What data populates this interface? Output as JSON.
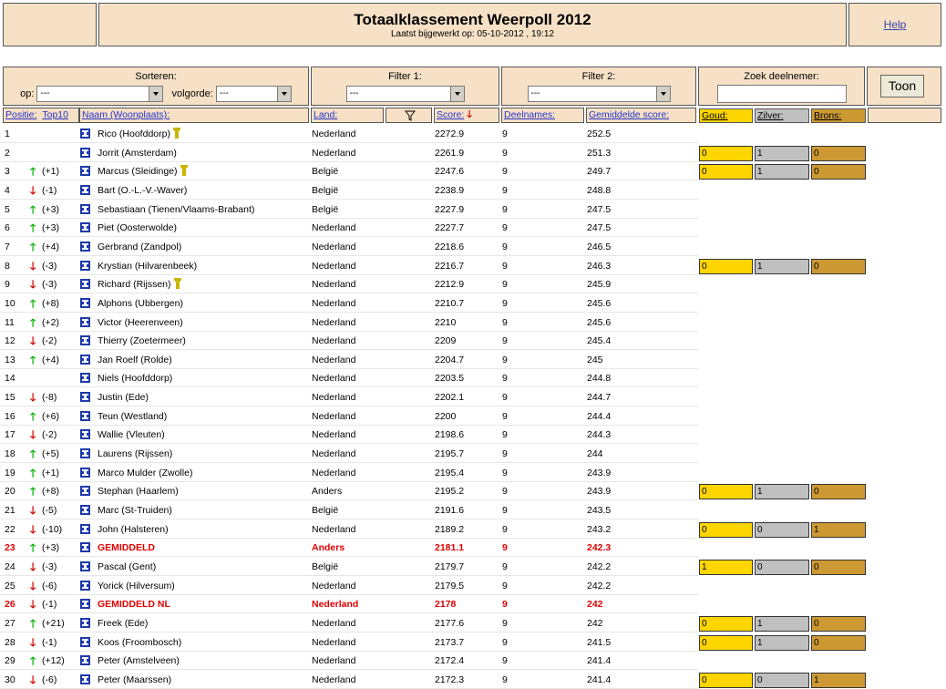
{
  "header": {
    "title": "Totaalklassement Weerpoll 2012",
    "subtitle": "Laatst bijgewerkt op: 05-10-2012 , 19:12",
    "help": "Help"
  },
  "controls": {
    "sorteren_label": "Sorteren:",
    "op_label": "op:",
    "op_value": "---",
    "volgorde_label": "volgorde:",
    "volgorde_value": "---",
    "filter1_label": "Filter 1:",
    "filter1_value": "---",
    "filter2_label": "Filter 2:",
    "filter2_value": "---",
    "zoek_label": "Zoek deelnemer:",
    "zoek_value": "",
    "toon": "Toon"
  },
  "columns": {
    "positie": "Positie:",
    "top10": "Top10",
    "naam": "Naam (Woonplaats):",
    "land": "Land:",
    "score": "Score:",
    "deelnames": "Deelnames:",
    "gemiddelde": "Gemiddelde score:",
    "goud": "Goud:",
    "zilver": "Zilver:",
    "brons": "Brons:"
  },
  "colors": {
    "gold": "#ffd500",
    "silver": "#c0c0c0",
    "bronze": "#cc9933",
    "panel": "#f7e1c6",
    "up": "#00b000",
    "down": "#d00000",
    "highlight": "#e00000"
  },
  "rows": [
    {
      "pos": "1",
      "dir": "",
      "chg": "",
      "name": "Rico (Hoofddorp)",
      "trophy": true,
      "land": "Nederland",
      "score": "2272.9",
      "deel": "9",
      "gem": "252.5",
      "medals": null
    },
    {
      "pos": "2",
      "dir": "",
      "chg": "",
      "name": "Jorrit (Amsterdam)",
      "trophy": false,
      "land": "Nederland",
      "score": "2261.9",
      "deel": "9",
      "gem": "251.3",
      "medals": [
        "0",
        "1",
        "0"
      ]
    },
    {
      "pos": "3",
      "dir": "up",
      "chg": "(+1)",
      "name": "Marcus (Sleidinge)",
      "trophy": true,
      "land": "België",
      "score": "2247.6",
      "deel": "9",
      "gem": "249.7",
      "medals": [
        "0",
        "1",
        "0"
      ]
    },
    {
      "pos": "4",
      "dir": "down",
      "chg": "(-1)",
      "name": "Bart (O.-L.-V.-Waver)",
      "trophy": false,
      "land": "België",
      "score": "2238.9",
      "deel": "9",
      "gem": "248.8",
      "medals": null
    },
    {
      "pos": "5",
      "dir": "up",
      "chg": "(+3)",
      "name": "Sebastiaan (Tienen/Vlaams-Brabant)",
      "trophy": false,
      "land": "België",
      "score": "2227.9",
      "deel": "9",
      "gem": "247.5",
      "medals": null
    },
    {
      "pos": "6",
      "dir": "up",
      "chg": "(+3)",
      "name": "Piet (Oosterwolde)",
      "trophy": false,
      "land": "Nederland",
      "score": "2227.7",
      "deel": "9",
      "gem": "247.5",
      "medals": null
    },
    {
      "pos": "7",
      "dir": "up",
      "chg": "(+4)",
      "name": "Gerbrand (Zandpol)",
      "trophy": false,
      "land": "Nederland",
      "score": "2218.6",
      "deel": "9",
      "gem": "246.5",
      "medals": null
    },
    {
      "pos": "8",
      "dir": "down",
      "chg": "(-3)",
      "name": "Krystian (Hilvarenbeek)",
      "trophy": false,
      "land": "Nederland",
      "score": "2216.7",
      "deel": "9",
      "gem": "246.3",
      "medals": [
        "0",
        "1",
        "0"
      ]
    },
    {
      "pos": "9",
      "dir": "down",
      "chg": "(-3)",
      "name": "Richard (Rijssen)",
      "trophy": true,
      "land": "Nederland",
      "score": "2212.9",
      "deel": "9",
      "gem": "245.9",
      "medals": null
    },
    {
      "pos": "10",
      "dir": "up",
      "chg": "(+8)",
      "name": "Alphons (Ubbergen)",
      "trophy": false,
      "land": "Nederland",
      "score": "2210.7",
      "deel": "9",
      "gem": "245.6",
      "medals": null
    },
    {
      "pos": "11",
      "dir": "up",
      "chg": "(+2)",
      "name": "Victor (Heerenveen)",
      "trophy": false,
      "land": "Nederland",
      "score": "2210",
      "deel": "9",
      "gem": "245.6",
      "medals": null
    },
    {
      "pos": "12",
      "dir": "down",
      "chg": "(-2)",
      "name": "Thierry (Zoetermeer)",
      "trophy": false,
      "land": "Nederland",
      "score": "2209",
      "deel": "9",
      "gem": "245.4",
      "medals": null
    },
    {
      "pos": "13",
      "dir": "up",
      "chg": "(+4)",
      "name": "Jan Roelf (Rolde)",
      "trophy": false,
      "land": "Nederland",
      "score": "2204.7",
      "deel": "9",
      "gem": "245",
      "medals": null
    },
    {
      "pos": "14",
      "dir": "",
      "chg": "",
      "name": "Niels (Hoofddorp)",
      "trophy": false,
      "land": "Nederland",
      "score": "2203.5",
      "deel": "9",
      "gem": "244.8",
      "medals": null
    },
    {
      "pos": "15",
      "dir": "down",
      "chg": "(-8)",
      "name": "Justin (Ede)",
      "trophy": false,
      "land": "Nederland",
      "score": "2202.1",
      "deel": "9",
      "gem": "244.7",
      "medals": null
    },
    {
      "pos": "16",
      "dir": "up",
      "chg": "(+6)",
      "name": "Teun (Westland)",
      "trophy": false,
      "land": "Nederland",
      "score": "2200",
      "deel": "9",
      "gem": "244.4",
      "medals": null
    },
    {
      "pos": "17",
      "dir": "down",
      "chg": "(-2)",
      "name": "Wallie (Vleuten)",
      "trophy": false,
      "land": "Nederland",
      "score": "2198.6",
      "deel": "9",
      "gem": "244.3",
      "medals": null
    },
    {
      "pos": "18",
      "dir": "up",
      "chg": "(+5)",
      "name": "Laurens (Rijssen)",
      "trophy": false,
      "land": "Nederland",
      "score": "2195.7",
      "deel": "9",
      "gem": "244",
      "medals": null
    },
    {
      "pos": "19",
      "dir": "up",
      "chg": "(+1)",
      "name": "Marco Mulder (Zwolle)",
      "trophy": false,
      "land": "Nederland",
      "score": "2195.4",
      "deel": "9",
      "gem": "243.9",
      "medals": null
    },
    {
      "pos": "20",
      "dir": "up",
      "chg": "(+8)",
      "name": "Stephan (Haarlem)",
      "trophy": false,
      "land": "Anders",
      "score": "2195.2",
      "deel": "9",
      "gem": "243.9",
      "medals": [
        "0",
        "1",
        "0"
      ]
    },
    {
      "pos": "21",
      "dir": "down",
      "chg": "(-5)",
      "name": "Marc (St-Truiden)",
      "trophy": false,
      "land": "België",
      "score": "2191.6",
      "deel": "9",
      "gem": "243.5",
      "medals": null
    },
    {
      "pos": "22",
      "dir": "down",
      "chg": "(-10)",
      "name": "John (Halsteren)",
      "trophy": false,
      "land": "Nederland",
      "score": "2189.2",
      "deel": "9",
      "gem": "243.2",
      "medals": [
        "0",
        "0",
        "1"
      ]
    },
    {
      "pos": "23",
      "dir": "up",
      "chg": "(+3)",
      "name": "GEMIDDELD",
      "trophy": false,
      "land": "Anders",
      "score": "2181.1",
      "deel": "9",
      "gem": "242.3",
      "medals": null,
      "highlight": true
    },
    {
      "pos": "24",
      "dir": "down",
      "chg": "(-3)",
      "name": "Pascal (Gent)",
      "trophy": false,
      "land": "België",
      "score": "2179.7",
      "deel": "9",
      "gem": "242.2",
      "medals": [
        "1",
        "0",
        "0"
      ]
    },
    {
      "pos": "25",
      "dir": "down",
      "chg": "(-6)",
      "name": "Yorick (Hilversum)",
      "trophy": false,
      "land": "Nederland",
      "score": "2179.5",
      "deel": "9",
      "gem": "242.2",
      "medals": null
    },
    {
      "pos": "26",
      "dir": "down",
      "chg": "(-1)",
      "name": "GEMIDDELD NL",
      "trophy": false,
      "land": "Nederland",
      "score": "2178",
      "deel": "9",
      "gem": "242",
      "medals": null,
      "highlight": true
    },
    {
      "pos": "27",
      "dir": "up",
      "chg": "(+21)",
      "name": "Freek (Ede)",
      "trophy": false,
      "land": "Nederland",
      "score": "2177.6",
      "deel": "9",
      "gem": "242",
      "medals": [
        "0",
        "1",
        "0"
      ]
    },
    {
      "pos": "28",
      "dir": "down",
      "chg": "(-1)",
      "name": "Koos (Froombosch)",
      "trophy": false,
      "land": "Nederland",
      "score": "2173.7",
      "deel": "9",
      "gem": "241.5",
      "medals": [
        "0",
        "1",
        "0"
      ]
    },
    {
      "pos": "29",
      "dir": "up",
      "chg": "(+12)",
      "name": "Peter (Amstelveen)",
      "trophy": false,
      "land": "Nederland",
      "score": "2172.4",
      "deel": "9",
      "gem": "241.4",
      "medals": null
    },
    {
      "pos": "30",
      "dir": "down",
      "chg": "(-6)",
      "name": "Peter (Maarssen)",
      "trophy": false,
      "land": "Nederland",
      "score": "2172.3",
      "deel": "9",
      "gem": "241.4",
      "medals": [
        "0",
        "0",
        "1"
      ]
    }
  ]
}
